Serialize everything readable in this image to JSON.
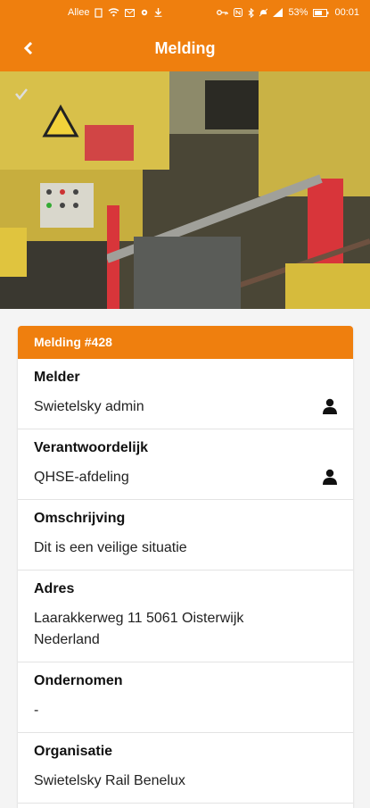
{
  "status_bar": {
    "carrier": "Allee",
    "battery": "53%",
    "time": "00:01"
  },
  "header": {
    "title": "Melding",
    "back_icon": "arrow-left-icon"
  },
  "card": {
    "title": "Melding #428",
    "fields": [
      {
        "label": "Melder",
        "value": "Swietelsky admin",
        "icon": "person-icon"
      },
      {
        "label": "Verantwoordelijk",
        "value": "QHSE-afdeling",
        "icon": "person-icon"
      },
      {
        "label": "Omschrijving",
        "value": "Dit is een veilige situatie"
      },
      {
        "label": "Adres",
        "value_line1": "Laarakkerweg 11 5061 Oisterwijk",
        "value_line2": "Nederland"
      },
      {
        "label": "Ondernomen",
        "value": "-"
      },
      {
        "label": "Organisatie",
        "value": "Swietelsky Rail Benelux"
      }
    ]
  },
  "colors": {
    "accent": "#ef7f0e"
  }
}
